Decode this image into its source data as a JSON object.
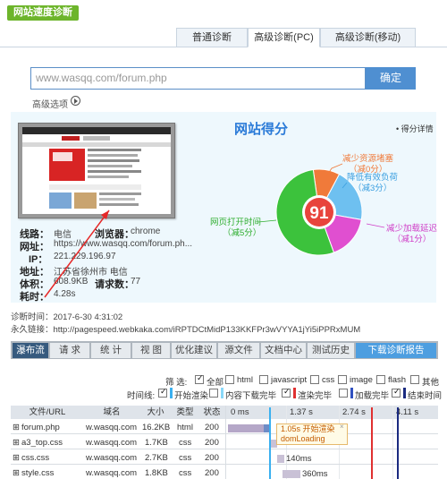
{
  "header": {
    "brand": "网站速度诊断",
    "tabs": [
      "普通诊断",
      "高级诊断(PC)",
      "高级诊断(移动)"
    ]
  },
  "search": {
    "value": "www.wasqq.com/forum.php",
    "button": "确定",
    "advanced": "高级选项"
  },
  "site_info": {
    "route_key": "线路：",
    "route_val": "电信",
    "browser_key": "浏览器：",
    "browser_val": "chrome",
    "url_key": "网址：",
    "url_val": "https://www.wasqq.com/forum.ph...",
    "ip_key": "IP：",
    "ip_val": "221.229.196.97",
    "location_key": "地址：",
    "location_val": "江苏省徐州市 电信",
    "size_key": "体积：",
    "size_val": "608.9KB",
    "requests_key": "请求数：",
    "requests_val": "77",
    "time_key": "耗时：",
    "time_val": "4.28s"
  },
  "score": {
    "title": "网站得分",
    "detail": "得分详情",
    "value": "91",
    "segments": [
      {
        "label": "减少资源堵塞",
        "sub": "（减0分）",
        "color": "#f07a3a"
      },
      {
        "label": "降低有效负荷",
        "sub": "（减3分）",
        "color": "#6ec0f0"
      },
      {
        "label": "减少加载延迟",
        "sub": "（减1分）",
        "color": "#e04fd0"
      },
      {
        "label": "网页打开时间",
        "sub": "（减5分）",
        "color": "#3cc23c"
      }
    ],
    "ring_color": "#e8443c"
  },
  "meta": {
    "diag_time": "诊断时间：2017-6-30 4:31:02",
    "permalink": "永久链接：http://pagespeed.webkaka.com/iRPTDCtMidP133KKFPr3wVYYA1jYi5iPPRxMUM"
  },
  "toolbar": [
    "瀑布流",
    "请 求",
    "统 计",
    "视 图",
    "优化建议",
    "源文件",
    "文档中心",
    "测试历史",
    "下载诊断报告"
  ],
  "filter": {
    "label": "筛 选:",
    "options": [
      {
        "label": "全部",
        "checked": true
      },
      {
        "label": "html",
        "checked": false
      },
      {
        "label": "javascript",
        "checked": false
      },
      {
        "label": "css",
        "checked": false
      },
      {
        "label": "image",
        "checked": false
      },
      {
        "label": "flash",
        "checked": false
      },
      {
        "label": "其他",
        "checked": false
      }
    ]
  },
  "timeline": {
    "label": "时间线:",
    "options": [
      {
        "label": "开始渲染",
        "checked": true,
        "color": "#3ab0f0"
      },
      {
        "label": "内容下载完毕",
        "checked": false,
        "color": "#88d8f8"
      },
      {
        "label": "渲染完毕",
        "checked": true,
        "color": "#e03030"
      },
      {
        "label": "加载完毕",
        "checked": false,
        "color": "#3050c0"
      },
      {
        "label": "结束时间",
        "checked": true,
        "color": "#1a2a80"
      }
    ]
  },
  "table": {
    "headers": [
      "文件/URL",
      "域名",
      "大小",
      "类型",
      "状态",
      "0 ms",
      "1.37 s",
      "2.74 s",
      "4.11 s"
    ],
    "rows": [
      {
        "file": "forum.php",
        "domain": "w.wasqq.com",
        "size": "16.2KB",
        "type": "html",
        "status": "200"
      },
      {
        "file": "a3_top.css",
        "domain": "w.wasqq.com",
        "size": "1.7KB",
        "type": "css",
        "status": "200"
      },
      {
        "file": "css.css",
        "domain": "w.wasqq.com",
        "size": "2.7KB",
        "type": "css",
        "status": "200"
      },
      {
        "file": "style.css",
        "domain": "w.wasqq.com",
        "size": "1.8KB",
        "type": "css",
        "status": "200"
      }
    ],
    "bar_labels": [
      "140ms",
      "360ms"
    ],
    "tooltip_time": "1.05s 开始渲染",
    "tooltip_event": "domLoading"
  }
}
